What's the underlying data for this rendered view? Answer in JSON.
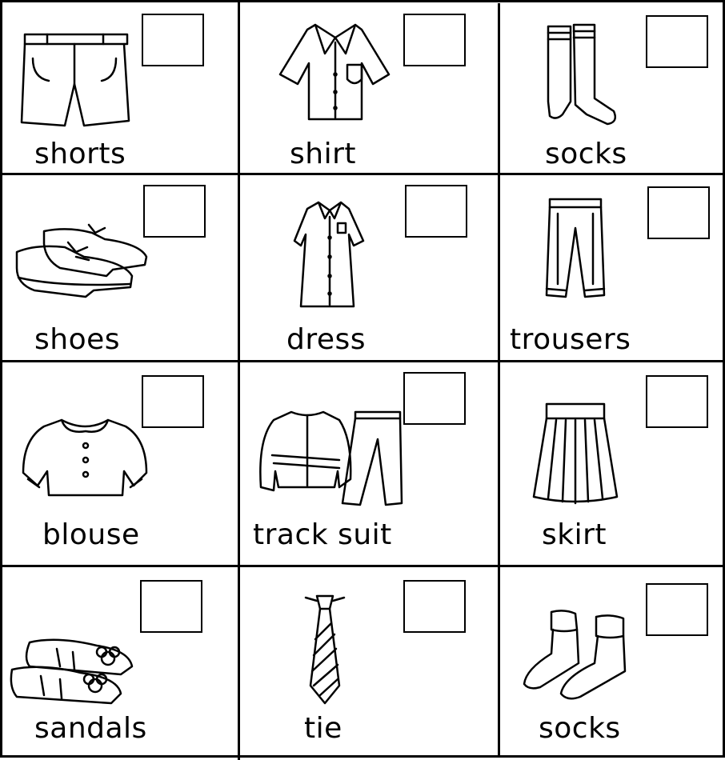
{
  "worksheet": {
    "items": [
      {
        "label": "shorts",
        "icon": "shorts-icon"
      },
      {
        "label": "shirt",
        "icon": "shirt-icon"
      },
      {
        "label": "socks",
        "icon": "socks-icon"
      },
      {
        "label": "shoes",
        "icon": "shoes-icon"
      },
      {
        "label": "dress",
        "icon": "dress-icon"
      },
      {
        "label": "trousers",
        "icon": "trousers-icon"
      },
      {
        "label": "blouse",
        "icon": "blouse-icon"
      },
      {
        "label": "track suit",
        "icon": "track-suit-icon"
      },
      {
        "label": "skirt",
        "icon": "skirt-icon"
      },
      {
        "label": "sandals",
        "icon": "sandals-icon"
      },
      {
        "label": "tie",
        "icon": "tie-icon"
      },
      {
        "label": "socks",
        "icon": "ankle-socks-icon"
      }
    ]
  }
}
